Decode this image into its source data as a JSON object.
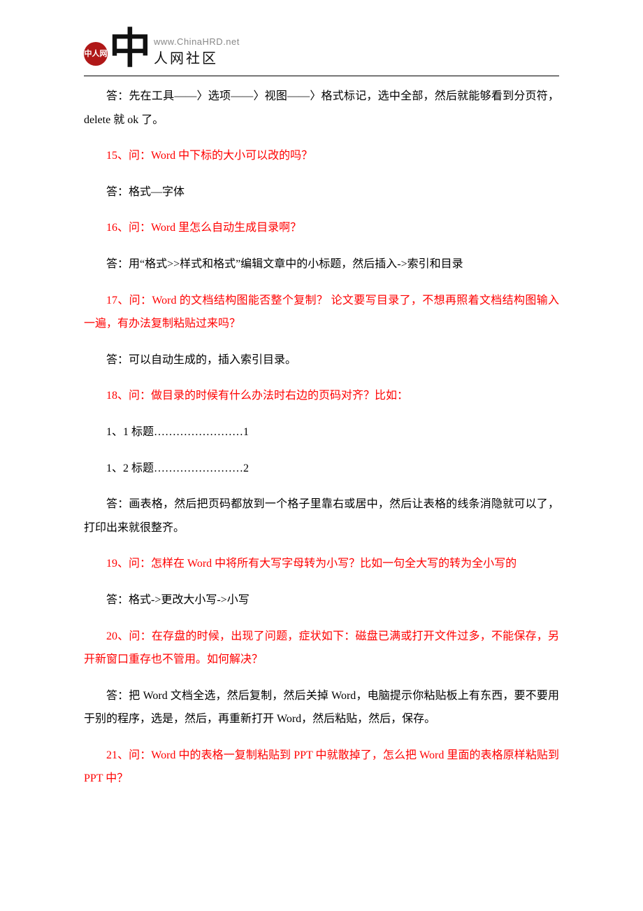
{
  "logo": {
    "mark": "中人网",
    "big": "中",
    "url": "www.ChinaHRD.net",
    "sub": "人网社区"
  },
  "paras": [
    {
      "cls": "a indent",
      "text": "答：先在工具——〉选项——〉视图——〉格式标记，选中全部，然后就能够看到分页符，delete 就 ok 了。"
    },
    {
      "cls": "q indent",
      "text": "15、问：Word 中下标的大小可以改的吗？"
    },
    {
      "cls": "a indent",
      "text": "答：格式—字体"
    },
    {
      "cls": "q indent",
      "text": "16、问：Word 里怎么自动生成目录啊？"
    },
    {
      "cls": "a indent",
      "text": "答：用“格式>>样式和格式”编辑文章中的小标题，然后插入->索引和目录"
    },
    {
      "cls": "q indent",
      "text": "17、问：Word 的文档结构图能否整个复制？ 论文要写目录了，不想再照着文档结构图输入一遍，有办法复制粘贴过来吗？"
    },
    {
      "cls": "a indent",
      "text": "答：可以自动生成的，插入索引目录。"
    },
    {
      "cls": "q indent",
      "text": "18、问：做目录的时候有什么办法时右边的页码对齐？比如："
    },
    {
      "cls": "a indent",
      "text": "1、1 标题……………………1"
    },
    {
      "cls": "a indent",
      "text": "1、2 标题……………………2"
    },
    {
      "cls": "a indent",
      "text": "答：画表格，然后把页码都放到一个格子里靠右或居中，然后让表格的线条消隐就可以了，打印出来就很整齐。"
    },
    {
      "cls": "q indent",
      "text": "19、问：怎样在 Word 中将所有大写字母转为小写？比如一句全大写的转为全小写的"
    },
    {
      "cls": "a indent",
      "text": "答：格式->更改大小写->小写"
    },
    {
      "cls": "q indent",
      "text": "20、问：在存盘的时候，出现了问题，症状如下：磁盘已满或打开文件过多，不能保存，另开新窗口重存也不管用。如何解决？"
    },
    {
      "cls": "a indent",
      "text": "答：把 Word 文档全选，然后复制，然后关掉 Word，电脑提示你粘贴板上有东西，要不要用于别的程序，选是，然后，再重新打开 Word，然后粘贴，然后，保存。"
    },
    {
      "cls": "q indent",
      "text": "21、问：Word 中的表格一复制粘贴到 PPT 中就散掉了，怎么把 Word 里面的表格原样粘贴到 PPT 中？"
    }
  ]
}
